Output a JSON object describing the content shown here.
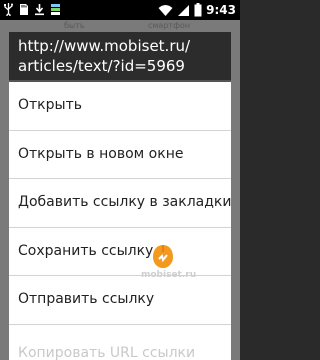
{
  "status_bar": {
    "time": "9:43",
    "icons_left": [
      "usb-icon",
      "sd-card-icon",
      "download-icon",
      "storage-icon"
    ],
    "icons_right": [
      "wifi-icon",
      "signal-icon",
      "battery-icon"
    ]
  },
  "background": {
    "snippets": [
      "быть",
      "смартфон"
    ]
  },
  "dialog": {
    "title": "http://www.mobiset.ru/\narticles/text/?id=5969",
    "items": [
      {
        "label": "Открыть"
      },
      {
        "label": "Открыть в новом окне"
      },
      {
        "label": "Добавить ссылку в закладки"
      },
      {
        "label": "Сохранить ссылку"
      },
      {
        "label": "Отправить ссылку"
      },
      {
        "label": "Копировать URL ссылки"
      }
    ]
  },
  "watermark": {
    "text": "mobiset.ru"
  },
  "colors": {
    "status_bar": "#000000",
    "dialog_title_bg": "#2c2c2c",
    "dialog_bg": "#ffffff",
    "divider": "#d3d3d3",
    "watermark_orange": "#f39a1e"
  }
}
